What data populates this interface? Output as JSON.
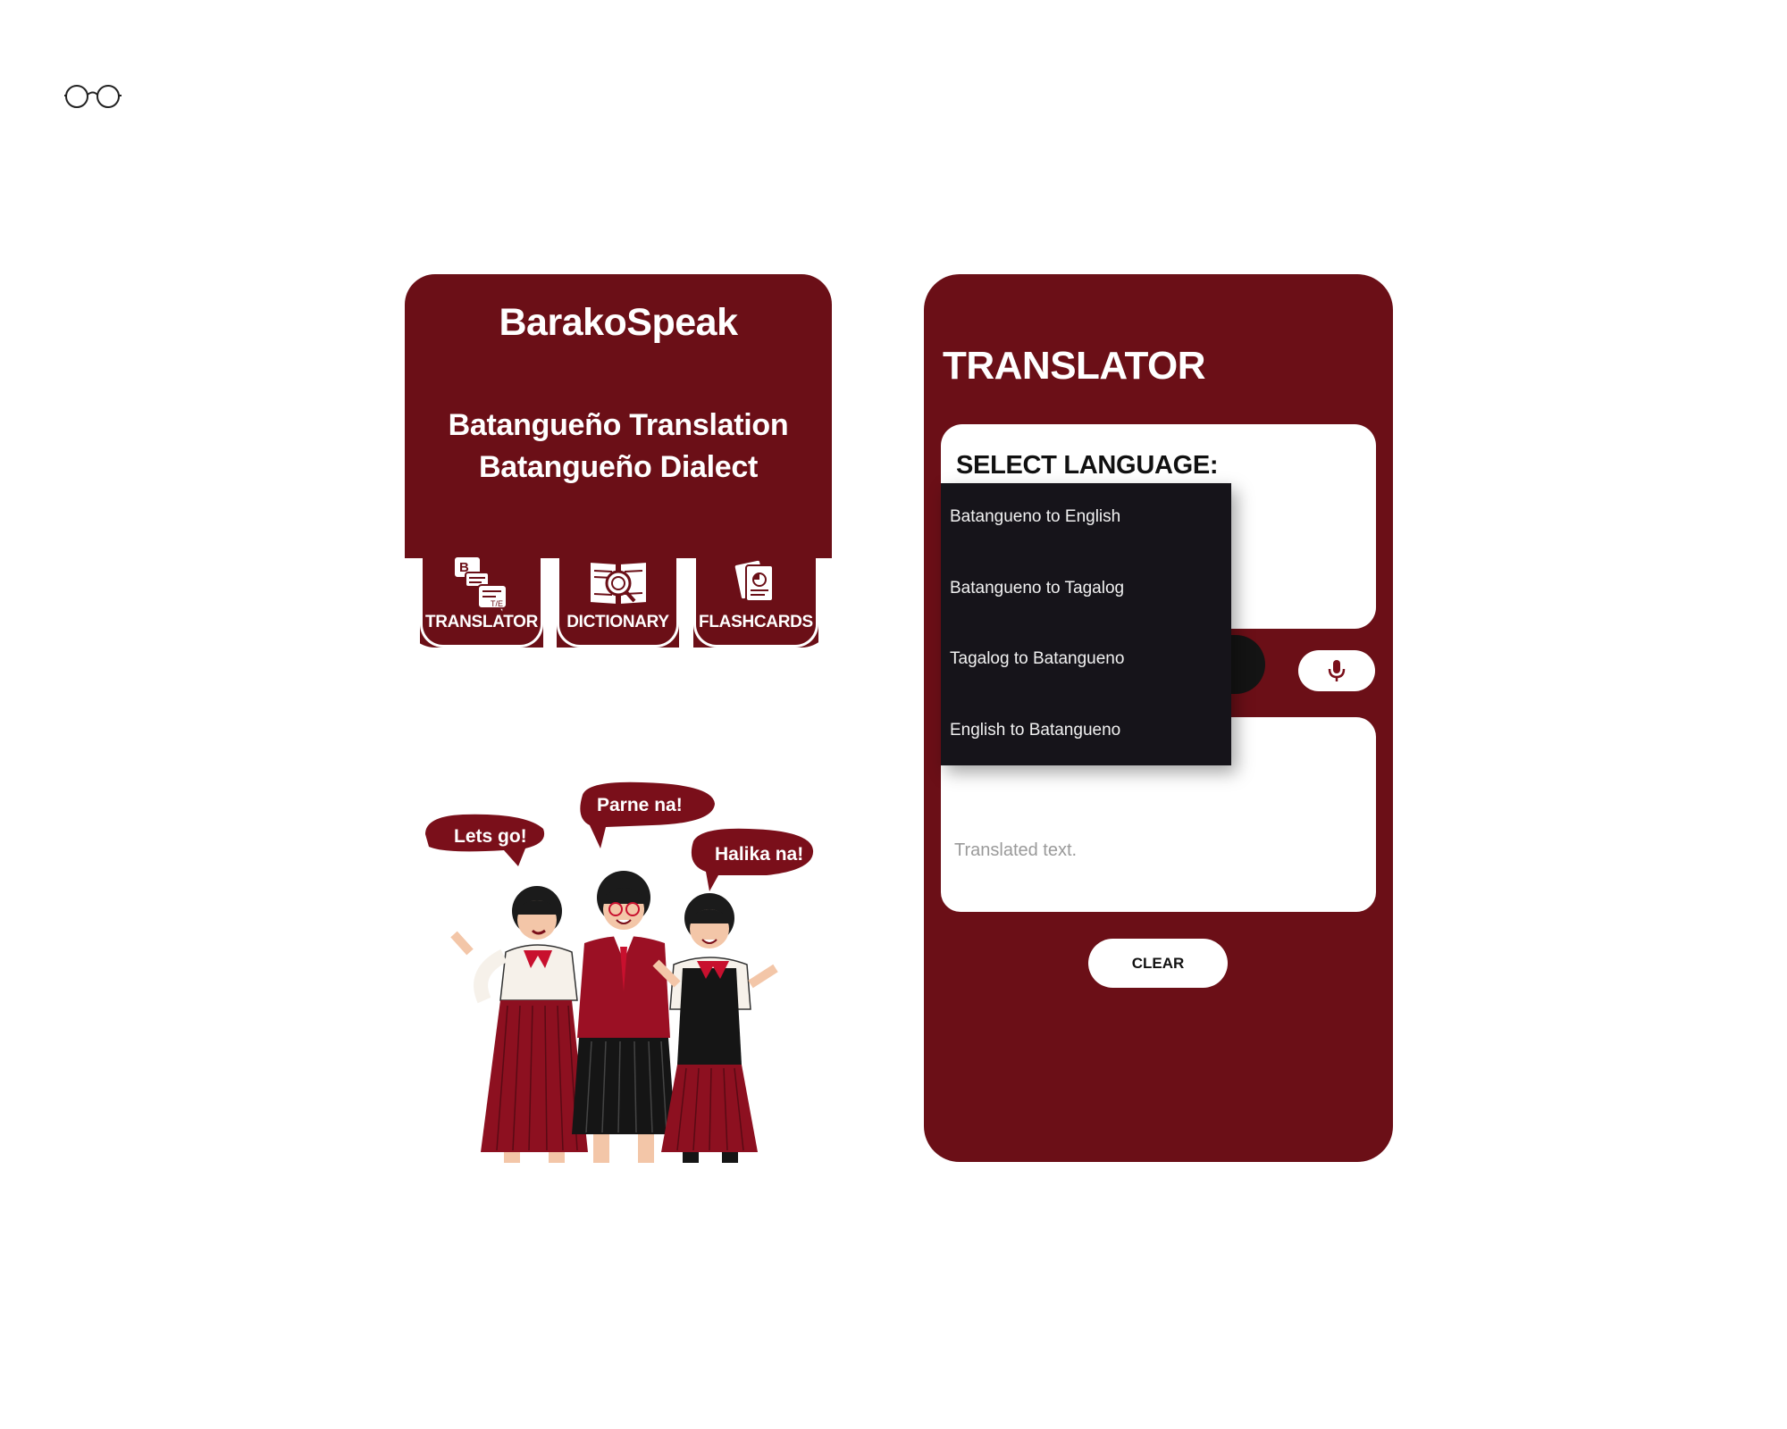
{
  "home": {
    "app_title": "BarakoSpeak",
    "tagline_line1": "Batangueño Translation",
    "tagline_line2": "Batangueño Dialect",
    "nav": {
      "translator_label": "TRANSLATOR",
      "dictionary_label": "DICTIONARY",
      "flashcards_label": "FLASHCARDS"
    },
    "illustration": {
      "bubble_left": "Lets go!",
      "bubble_center": "Parne na!",
      "bubble_right": "Halika na!"
    }
  },
  "translator": {
    "title": "TRANSLATOR",
    "select_label": "SELECT LANGUAGE:",
    "options": [
      "Batangueno to English",
      "Batangueno to Tagalog",
      "Tagalog to Batangueno",
      "English to Batangueno"
    ],
    "output_placeholder": "Translated text.",
    "clear_label": "CLEAR"
  },
  "colors": {
    "brand": "#6b0f17",
    "dropdown_bg": "#16141a",
    "surface": "#ffffff"
  },
  "icons": [
    "glasses-icon",
    "chat-translate-icon",
    "dictionary-search-icon",
    "flashcards-icon",
    "microphone-icon"
  ]
}
